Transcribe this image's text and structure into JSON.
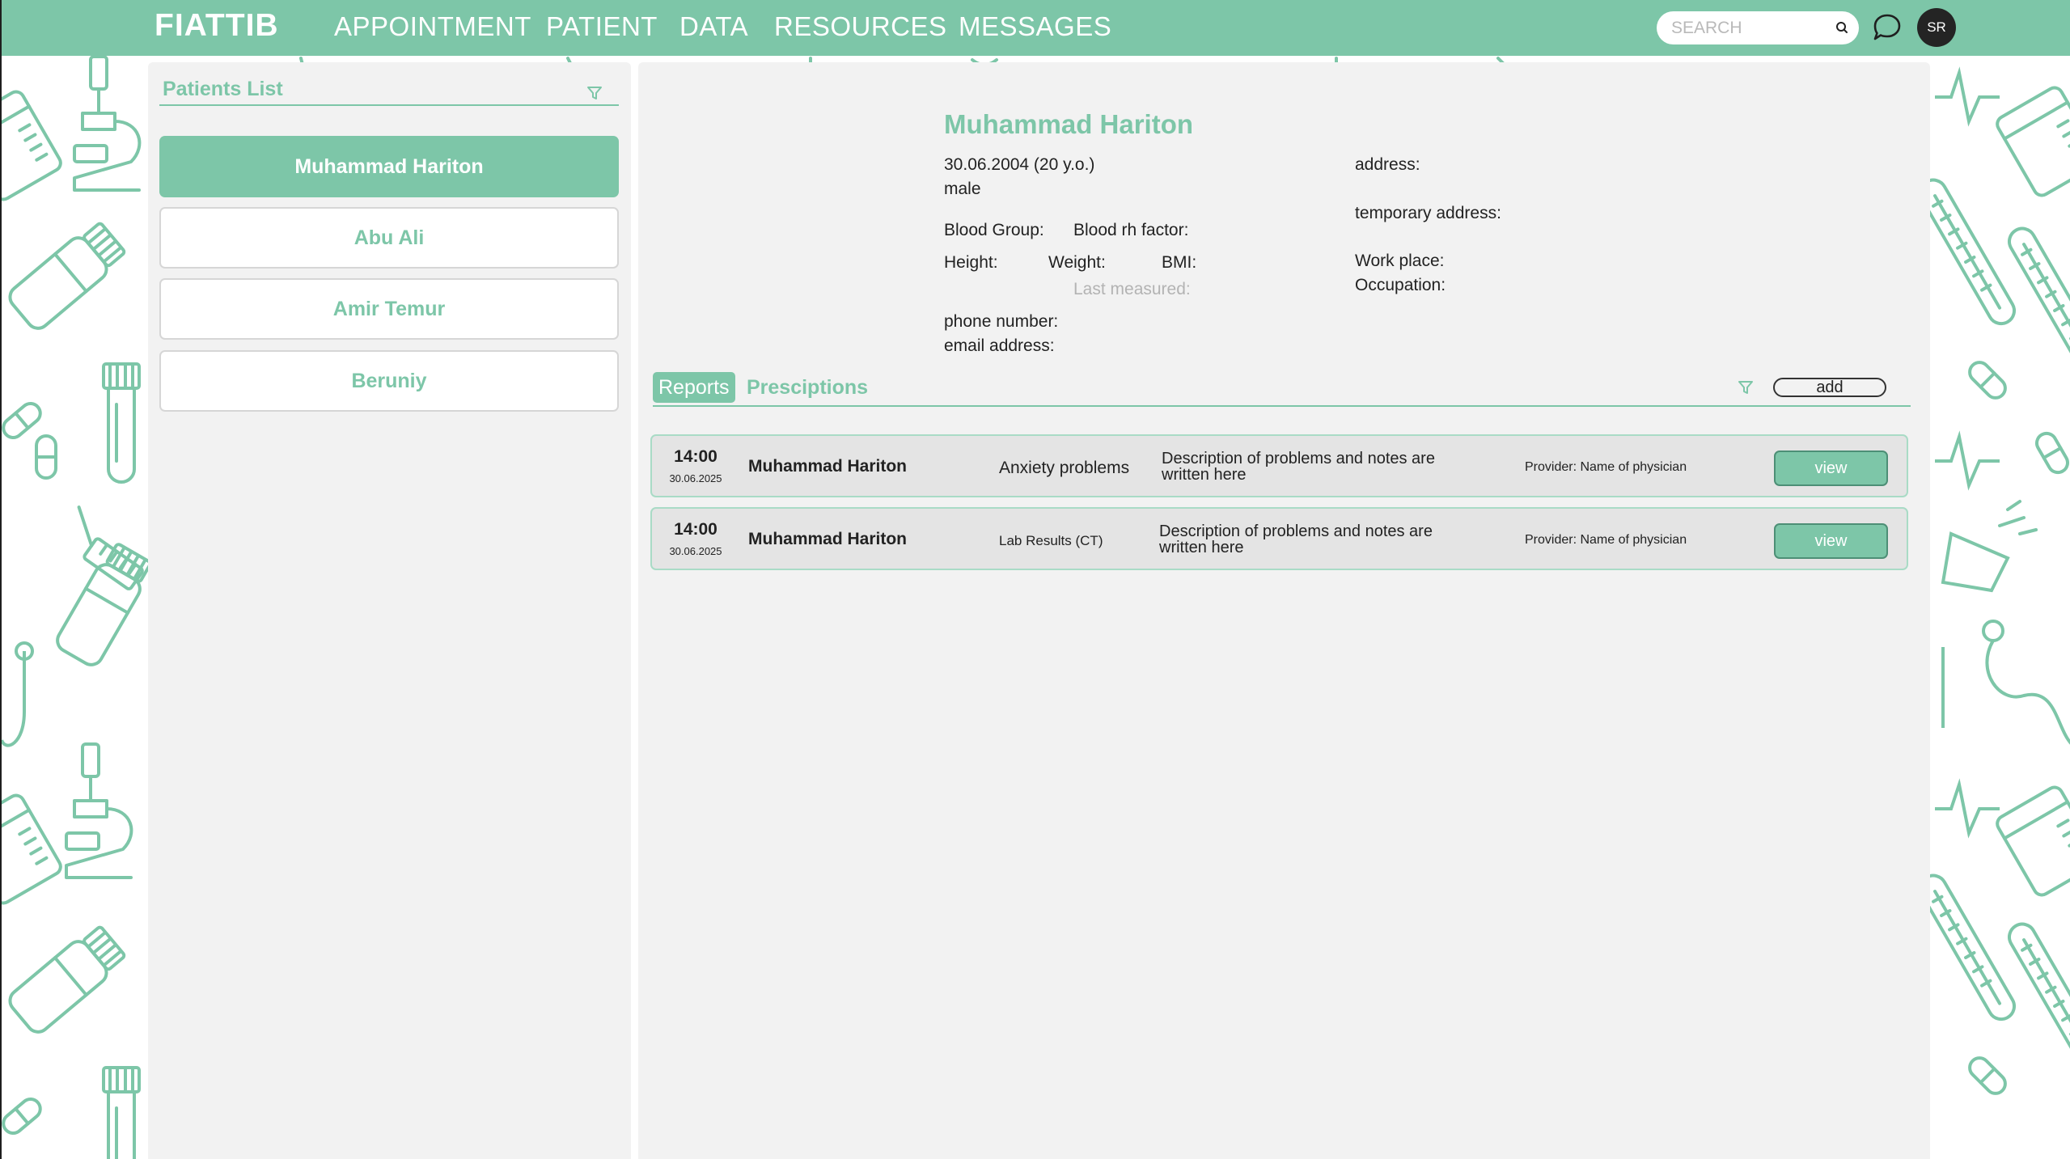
{
  "header": {
    "brand": "FIATTIB",
    "nav": [
      "APPOINTMENT",
      "PATIENT",
      "DATA",
      "RESOURCES",
      "MESSAGES"
    ],
    "search_placeholder": "SEARCH",
    "avatar_initials": "SR",
    "accent_color": "#7dc6a8"
  },
  "patients_list": {
    "title": "Patients List",
    "patients": [
      "Muhammad Hariton",
      "Abu Ali",
      "Amir Temur",
      "Beruniy"
    ],
    "selected_index": 0
  },
  "patient": {
    "name": "Muhammad Hariton",
    "dob": "30.06.2004 (20 y.o.)",
    "gender": "male",
    "blood_group_label": "Blood Group:",
    "blood_rh_label": "Blood rh factor:",
    "height_label": "Height:",
    "weight_label": "Weight:",
    "bmi_label": "BMI:",
    "last_measured_label": "Last measured:",
    "phone_label": "phone number:",
    "email_label": "email address:",
    "address_label": "address:",
    "temp_address_label": "temporary address:",
    "work_place_label": "Work place:",
    "occupation_label": "Occupation:"
  },
  "tabs": {
    "reports": "Reports",
    "prescriptions": "Presciptions",
    "active": "Reports",
    "add_label": "add"
  },
  "reports": [
    {
      "time": "14:00",
      "date": "30.06.2025",
      "patient": "Muhammad Hariton",
      "subject": "Anxiety problems",
      "description": "Description of problems and notes are written here",
      "provider": "Provider: Name of physician",
      "button": "view"
    },
    {
      "time": "14:00",
      "date": "30.06.2025",
      "patient": "Muhammad Hariton",
      "subject": "Lab Results (CT)",
      "description": "Description of problems and notes are written here",
      "provider": "Provider: Name of physician",
      "button": "view"
    }
  ]
}
